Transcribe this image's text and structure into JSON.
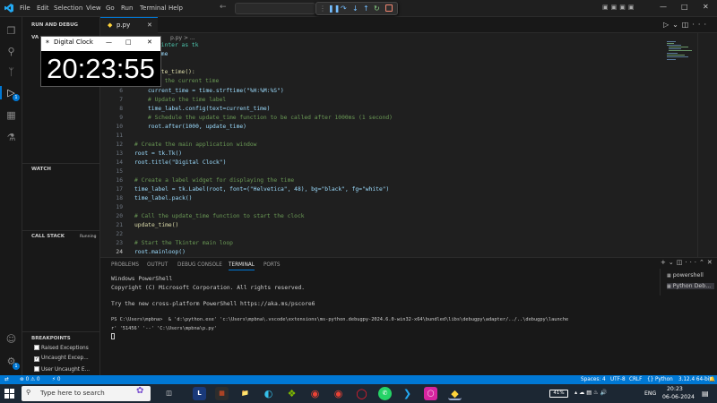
{
  "titlebar": {
    "menu": [
      "File",
      "Edit",
      "Selection",
      "View",
      "Go",
      "Run",
      "Terminal",
      "Help"
    ]
  },
  "sidebar": {
    "header": "RUN AND DEBUG",
    "variables_header": "VA",
    "watch_header": "WATCH",
    "callstack_header": "CALL STACK",
    "callstack_status": "Running",
    "breakpoints_header": "BREAKPOINTS",
    "breakpoints": [
      {
        "label": "Raised Exceptions",
        "checked": false
      },
      {
        "label": "Uncaught Excep...",
        "checked": true
      },
      {
        "label": "User Uncaught E...",
        "checked": false
      }
    ]
  },
  "activitybar": {
    "run_badge": "1",
    "settings_badge": "1"
  },
  "editor": {
    "tab_label": "p.py",
    "breadcrumb": "p.py > ...",
    "line_numbers": [
      "6",
      "7",
      "8",
      "9",
      "10",
      "11",
      "12",
      "13",
      "14",
      "15",
      "16",
      "17",
      "18",
      "19",
      "20",
      "21",
      "22",
      "23",
      "24"
    ],
    "code_fragments": {
      "l1": "kinter as tk",
      "l2": "ime",
      "l3": "ate_time():",
      "l4": "t the current time",
      "l6": "current_time = time.strftime(\"%H:%M:%S\")",
      "l7": "# Update the time label",
      "l8": "time_label.config(text=current_time)",
      "l9": "# Schedule the update_time function to be called after 1000ms (1 second)",
      "l10": "root.after(1000, update_time)",
      "l12": "# Create the main application window",
      "l13": "root = tk.Tk()",
      "l14": "root.title(\"Digital Clock\")",
      "l16": "# Create a label widget for displaying the time",
      "l17": "time_label = tk.Label(root, font=(\"Helvetica\", 48), bg=\"black\", fg=\"white\")",
      "l18": "time_label.pack()",
      "l20": "# Call the update_time function to start the clock",
      "l21": "update_time()",
      "l23": "# Start the Tkinter main loop",
      "l24": "root.mainloop()"
    }
  },
  "clock_window": {
    "title": "Digital Clock",
    "time": "20:23:55"
  },
  "panel": {
    "tabs": [
      "PROBLEMS",
      "OUTPUT",
      "DEBUG CONSOLE",
      "TERMINAL",
      "PORTS"
    ],
    "active_tab": "TERMINAL",
    "terminal_lines": [
      "Windows PowerShell",
      "Copyright (C) Microsoft Corporation. All rights reserved.",
      "",
      "Try the new cross-platform PowerShell https://aka.ms/pscore6",
      "",
      "PS C:\\Users\\mpbna>  & 'd:\\python.exe' 'c:\\Users\\mpbna\\.vscode\\extensions\\ms-python.debugpy-2024.6.0-win32-x64\\bundled\\libs\\debugpy\\adapter/../..\\debugpy\\launche",
      "r' '51456' '--' 'C:\\Users\\mpbna\\p.py'"
    ],
    "terminal_list": [
      "powershell",
      "Python Deb..."
    ]
  },
  "statusbar": {
    "errors": "0",
    "warnings": "0",
    "ports": "0",
    "spaces": "Spaces: 4",
    "encoding": "UTF-8",
    "eol": "CRLF",
    "language": "Python",
    "interpreter": "3.12.4 64-bit"
  },
  "taskbar": {
    "search_placeholder": "Type here to search",
    "battery": "41%",
    "language": "ENG",
    "time": "20:23",
    "date": "06-06-2024"
  },
  "colors": {
    "accent": "#0078d4",
    "editor_bg": "#1f1f1f",
    "sidebar_bg": "#181818"
  }
}
